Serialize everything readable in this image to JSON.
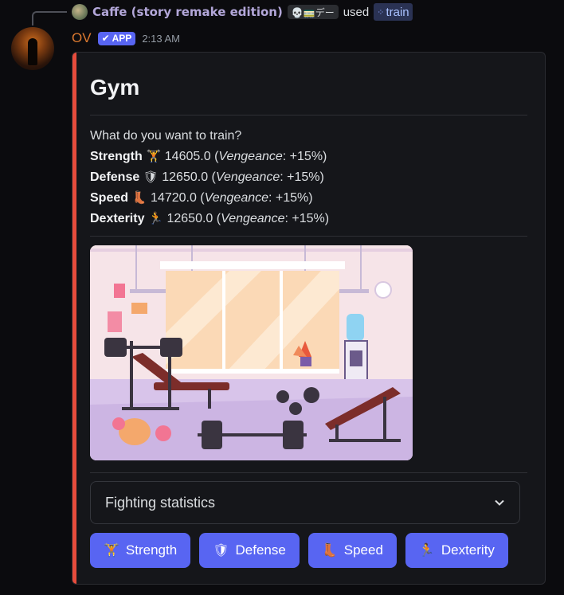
{
  "reply": {
    "user_name": "Caffe (story remake edition)",
    "user_tag": "💀🚃デー",
    "used_text": "used",
    "command_name": "train"
  },
  "message": {
    "author": "OV",
    "app_badge": "APP",
    "timestamp": "2:13 AM"
  },
  "embed": {
    "accent_color": "#e74c3c",
    "title": "Gym",
    "prompt": "What do you want to train?",
    "stats": [
      {
        "name": "Strength",
        "icon": "dumbbell-icon",
        "emoji": "🏋",
        "value": "14605.0",
        "bonus_label": "Vengeance",
        "bonus_value": ": +15%)"
      },
      {
        "name": "Defense",
        "icon": "shield-icon",
        "emoji": "🛡",
        "value": "12650.0",
        "bonus_label": "Vengeance",
        "bonus_value": ": +15%)"
      },
      {
        "name": "Speed",
        "icon": "boot-icon",
        "emoji": "👢",
        "value": "14720.0",
        "bonus_label": "Vengeance",
        "bonus_value": ": +15%)"
      },
      {
        "name": "Dexterity",
        "icon": "running-man-icon",
        "emoji": "🏃",
        "value": "12650.0",
        "bonus_label": "Vengeance",
        "bonus_value": ": +15%)"
      }
    ]
  },
  "select": {
    "value": "Fighting statistics"
  },
  "buttons": [
    {
      "label": "Strength",
      "emoji": "🏋"
    },
    {
      "label": "Defense",
      "emoji": "🛡"
    },
    {
      "label": "Speed",
      "emoji": "👢"
    },
    {
      "label": "Dexterity",
      "emoji": "🏃"
    }
  ],
  "colors": {
    "blurple": "#5865f2",
    "author": "#dd7a30",
    "background": "#0b0b0e",
    "embed_bg": "#15161a"
  }
}
